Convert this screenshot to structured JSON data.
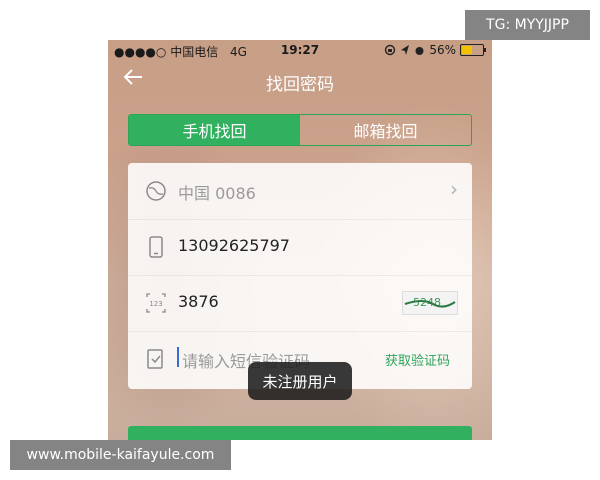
{
  "status_bar": {
    "signal": "●●●●○",
    "carrier": "中国电信",
    "network": "4G",
    "time": "19:27",
    "battery": "56%",
    "battery_level": 0.56
  },
  "navbar": {
    "back_icon": "back-arrow-icon",
    "title": "找回密码"
  },
  "tabs": [
    {
      "label": "手机找回",
      "active": true
    },
    {
      "label": "邮箱找回",
      "active": false
    }
  ],
  "form": {
    "country": "中国 0086",
    "phone": "13092625797",
    "captcha_value": "3876",
    "captcha_image_text": "5248",
    "sms_code_placeholder": "请输入短信验证码",
    "get_code_label": "获取验证码"
  },
  "toast": "未注册用户",
  "overlays": {
    "tg_label": "TG: MYYJJPP",
    "watermark": "www.mobile-kaifayule.com"
  },
  "colors": {
    "accent": "#31b060",
    "toast_bg": "#1e1e1e"
  }
}
